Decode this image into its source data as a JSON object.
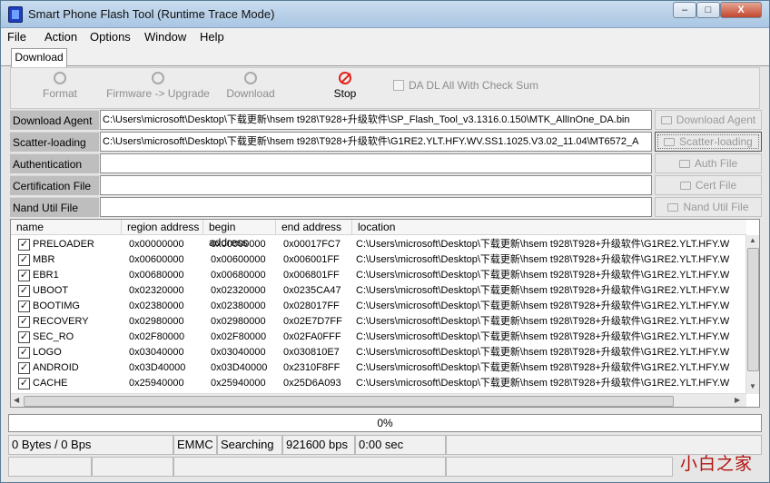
{
  "window": {
    "title": "Smart Phone Flash Tool (Runtime Trace Mode)",
    "min_label": "–",
    "max_label": "□",
    "close_label": "X"
  },
  "menu": [
    "File",
    "Action",
    "Options",
    "Window",
    "Help"
  ],
  "tab": "Download",
  "toolbar": {
    "format": "Format",
    "firmware_upgrade": "Firmware -> Upgrade",
    "download": "Download",
    "stop": "Stop",
    "checksum": "DA DL All With Check Sum"
  },
  "files": [
    {
      "label": "Download Agent",
      "value": "C:\\Users\\microsoft\\Desktop\\下载更新\\hsem t928\\T928+升级软件\\SP_Flash_Tool_v3.1316.0.150\\MTK_AllInOne_DA.bin",
      "button": "Download Agent"
    },
    {
      "label": "Scatter-loading File",
      "value": "C:\\Users\\microsoft\\Desktop\\下载更新\\hsem t928\\T928+升级软件\\G1RE2.YLT.HFY.WV.SS1.1025.V3.02_11.04\\MT6572_A",
      "button": "Scatter-loading"
    },
    {
      "label": "Authentication File",
      "value": "",
      "button": "Auth File"
    },
    {
      "label": "Certification File",
      "value": "",
      "button": "Cert File"
    },
    {
      "label": "Nand Util File",
      "value": "",
      "button": "Nand Util File"
    }
  ],
  "list": {
    "columns": [
      "name",
      "region address",
      "begin address",
      "end address",
      "location"
    ],
    "rows": [
      {
        "checked": "✓",
        "name": "PRELOADER",
        "region": "0x00000000",
        "begin": "0x00000000",
        "end": "0x00017FC7",
        "location": "C:\\Users\\microsoft\\Desktop\\下载更新\\hsem t928\\T928+升级软件\\G1RE2.YLT.HFY.W"
      },
      {
        "checked": "✓",
        "name": "MBR",
        "region": "0x00600000",
        "begin": "0x00600000",
        "end": "0x006001FF",
        "location": "C:\\Users\\microsoft\\Desktop\\下载更新\\hsem t928\\T928+升级软件\\G1RE2.YLT.HFY.W"
      },
      {
        "checked": "✓",
        "name": "EBR1",
        "region": "0x00680000",
        "begin": "0x00680000",
        "end": "0x006801FF",
        "location": "C:\\Users\\microsoft\\Desktop\\下载更新\\hsem t928\\T928+升级软件\\G1RE2.YLT.HFY.W"
      },
      {
        "checked": "✓",
        "name": "UBOOT",
        "region": "0x02320000",
        "begin": "0x02320000",
        "end": "0x0235CA47",
        "location": "C:\\Users\\microsoft\\Desktop\\下载更新\\hsem t928\\T928+升级软件\\G1RE2.YLT.HFY.W"
      },
      {
        "checked": "✓",
        "name": "BOOTIMG",
        "region": "0x02380000",
        "begin": "0x02380000",
        "end": "0x028017FF",
        "location": "C:\\Users\\microsoft\\Desktop\\下载更新\\hsem t928\\T928+升级软件\\G1RE2.YLT.HFY.W"
      },
      {
        "checked": "✓",
        "name": "RECOVERY",
        "region": "0x02980000",
        "begin": "0x02980000",
        "end": "0x02E7D7FF",
        "location": "C:\\Users\\microsoft\\Desktop\\下载更新\\hsem t928\\T928+升级软件\\G1RE2.YLT.HFY.W"
      },
      {
        "checked": "✓",
        "name": "SEC_RO",
        "region": "0x02F80000",
        "begin": "0x02F80000",
        "end": "0x02FA0FFF",
        "location": "C:\\Users\\microsoft\\Desktop\\下载更新\\hsem t928\\T928+升级软件\\G1RE2.YLT.HFY.W"
      },
      {
        "checked": "✓",
        "name": "LOGO",
        "region": "0x03040000",
        "begin": "0x03040000",
        "end": "0x030810E7",
        "location": "C:\\Users\\microsoft\\Desktop\\下载更新\\hsem t928\\T928+升级软件\\G1RE2.YLT.HFY.W"
      },
      {
        "checked": "✓",
        "name": "ANDROID",
        "region": "0x03D40000",
        "begin": "0x03D40000",
        "end": "0x2310F8FF",
        "location": "C:\\Users\\microsoft\\Desktop\\下载更新\\hsem t928\\T928+升级软件\\G1RE2.YLT.HFY.W"
      },
      {
        "checked": "✓",
        "name": "CACHE",
        "region": "0x25940000",
        "begin": "0x25940000",
        "end": "0x25D6A093",
        "location": "C:\\Users\\microsoft\\Desktop\\下载更新\\hsem t928\\T928+升级软件\\G1RE2.YLT.HFY.W"
      }
    ]
  },
  "progress": {
    "text": "0%",
    "fraction": 0
  },
  "status": {
    "bytes": "0 Bytes / 0 Bps",
    "storage": "EMMC",
    "state": "Searching",
    "baud": "921600 bps",
    "time": "0:00 sec"
  },
  "watermark": "小白之家"
}
